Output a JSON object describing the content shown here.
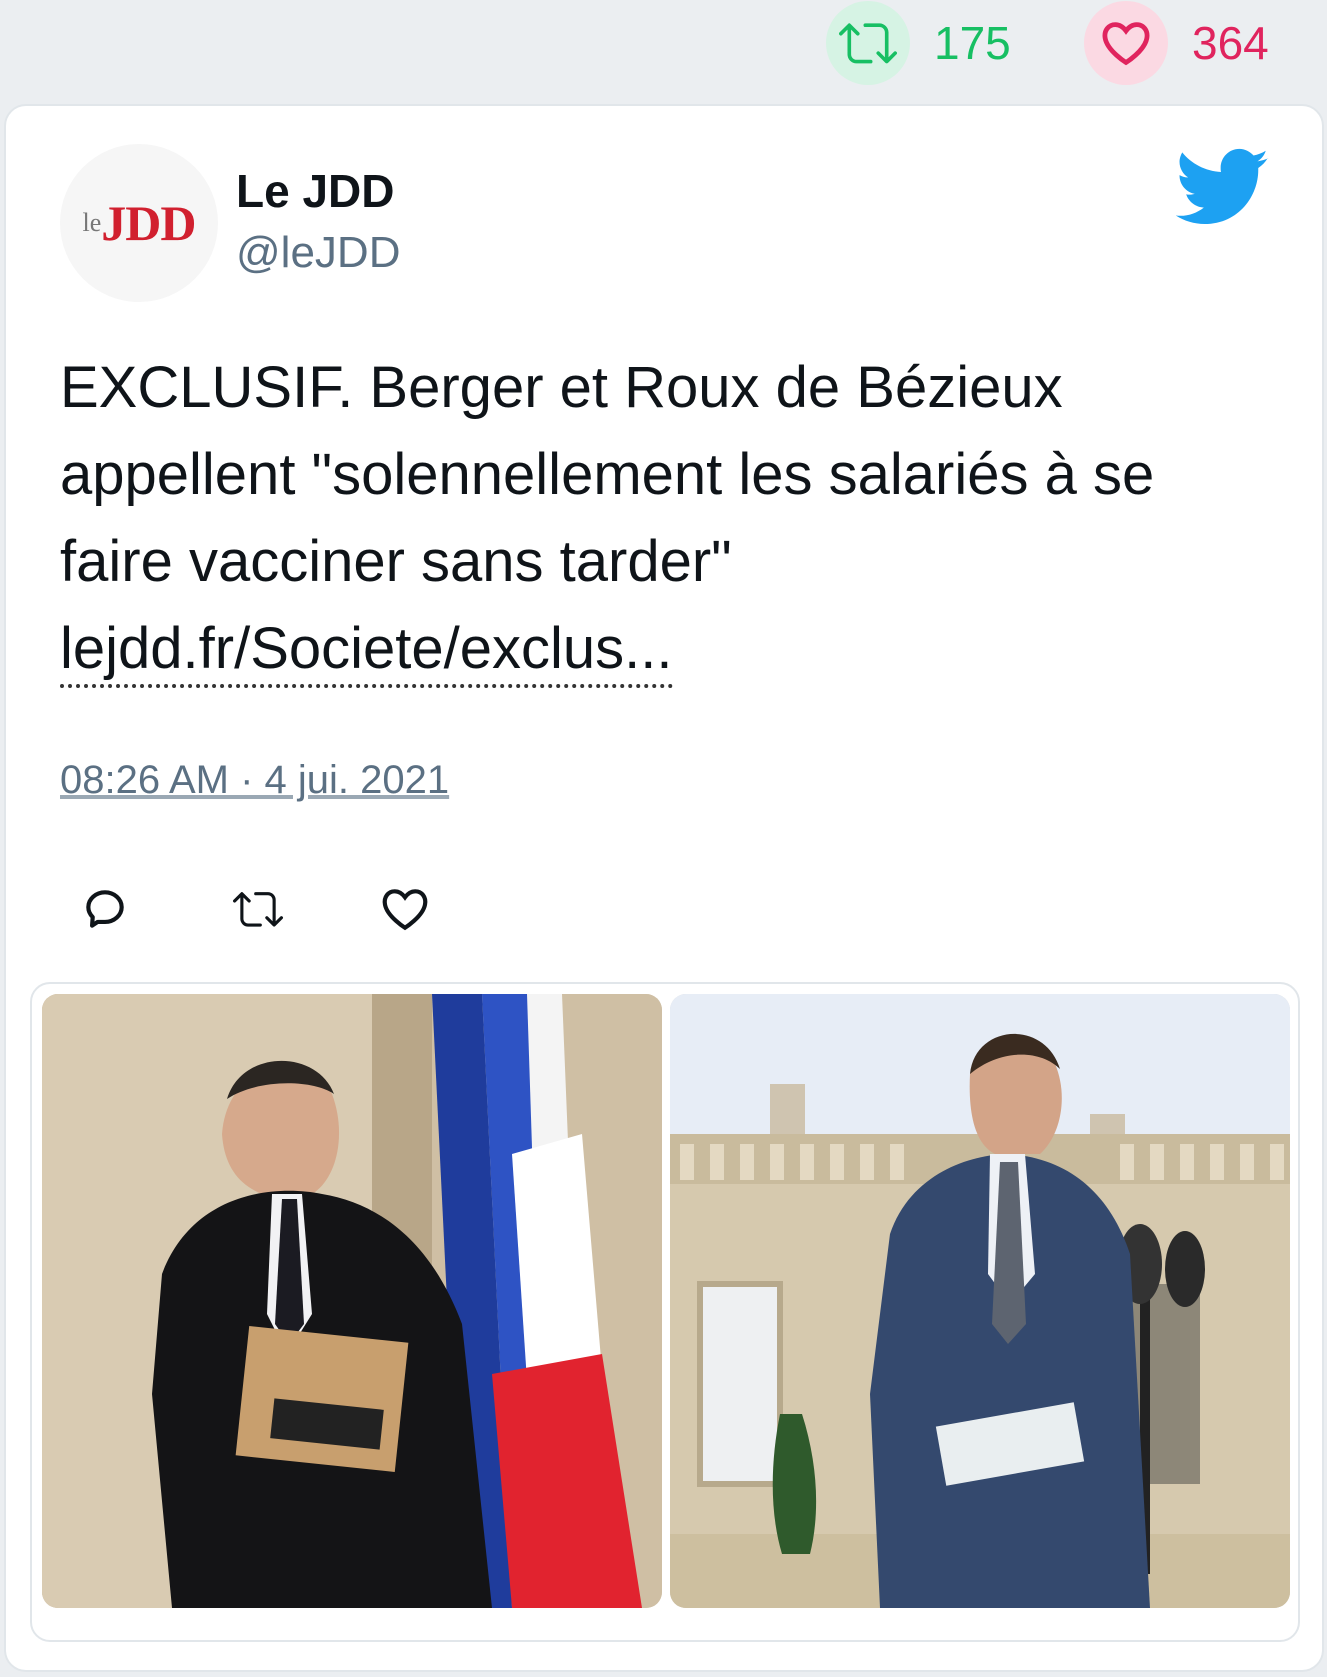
{
  "stats": {
    "retweet_count": "175",
    "like_count": "364"
  },
  "tweet": {
    "avatar": {
      "logo_prefix": "le",
      "logo_main": "JDD"
    },
    "display_name": "Le JDD",
    "handle": "@leJDD",
    "text": "EXCLUSIF. Berger et Roux de Bézieux appellent \"solennellement les salariés à se faire vacciner sans tarder\"",
    "link_text": "lejdd.fr/Societe/exclus...",
    "timestamp": "08:26 AM · 4 jui. 2021"
  },
  "icons": {
    "retweet": "retweet-icon",
    "like": "heart-icon",
    "reply": "reply-icon",
    "brand": "twitter-bird-icon"
  },
  "colors": {
    "retweet": "#17bf63",
    "like": "#e0245e",
    "handle": "#5b7083",
    "twitter_blue": "#1da1f2"
  }
}
